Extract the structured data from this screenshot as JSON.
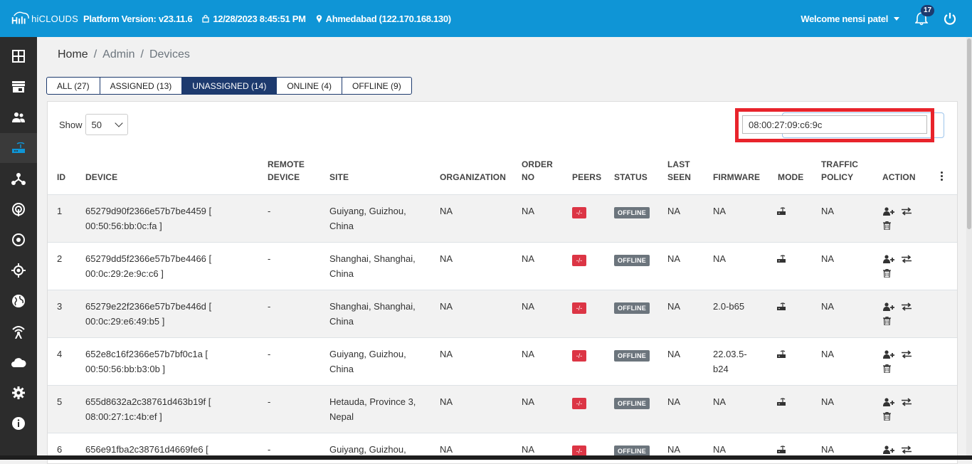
{
  "app": {
    "logo_text": "hiCLOUDS",
    "platform_version": "Platform Version: v23.11.6",
    "datetime": "12/28/2023 8:45:51 PM",
    "location": "Ahmedabad (122.170.168.130)",
    "welcome": "Welcome nensi patel",
    "notification_count": "17",
    "brand_color": "#0f95d6"
  },
  "sidebar": {
    "items": [
      {
        "icon": "dashboard-icon"
      },
      {
        "icon": "store-icon"
      },
      {
        "icon": "users-icon"
      },
      {
        "icon": "router-icon",
        "active": true
      },
      {
        "icon": "network-icon"
      },
      {
        "icon": "signal-icon"
      },
      {
        "icon": "target-icon"
      },
      {
        "icon": "crosshair-icon"
      },
      {
        "icon": "globe-icon"
      },
      {
        "icon": "wifi-tower-icon"
      },
      {
        "icon": "cloud-icon"
      },
      {
        "icon": "gear-icon"
      },
      {
        "icon": "info-icon"
      }
    ]
  },
  "breadcrumb": {
    "home": "Home",
    "sep1": "/",
    "admin": "Admin",
    "sep2": "/",
    "current": "Devices"
  },
  "tabs": [
    {
      "label": "ALL (27)"
    },
    {
      "label": "ASSIGNED (13)"
    },
    {
      "label": "UNASSIGNED (14)",
      "active": true
    },
    {
      "label": "ONLINE (4)"
    },
    {
      "label": "OFFLINE (9)"
    }
  ],
  "table_controls": {
    "show_label": "Show",
    "page_size": "50",
    "search_value": "08:00:27:09:c6:9c"
  },
  "columns": {
    "id": "ID",
    "device": "DEVICE",
    "remote_device_1": "REMOTE",
    "remote_device_2": "DEVICE",
    "site": "SITE",
    "organization": "ORGANIZATION",
    "order_no_1": "ORDER",
    "order_no_2": "NO",
    "peers": "PEERS",
    "status": "STATUS",
    "last_seen_1": "LAST",
    "last_seen_2": "SEEN",
    "firmware": "FIRMWARE",
    "mode": "MODE",
    "traffic_policy_1": "TRAFFIC",
    "traffic_policy_2": "POLICY",
    "action": "ACTION"
  },
  "rows": [
    {
      "id": "1",
      "device_1": "65279d90f2366e57b7be4459 [",
      "device_2": "00:50:56:bb:0c:fa ]",
      "remote": "-",
      "site_1": "Guiyang, Guizhou,",
      "site_2": "China",
      "org": "NA",
      "order": "NA",
      "peers": "-/-",
      "status": "OFFLINE",
      "last_seen": "NA",
      "firmware_1": "NA",
      "firmware_2": "",
      "policy": "NA"
    },
    {
      "id": "2",
      "device_1": "65279dd5f2366e57b7be4466 [",
      "device_2": "00:0c:29:2e:9c:c6 ]",
      "remote": "-",
      "site_1": "Shanghai, Shanghai,",
      "site_2": "China",
      "org": "NA",
      "order": "NA",
      "peers": "-/-",
      "status": "OFFLINE",
      "last_seen": "NA",
      "firmware_1": "NA",
      "firmware_2": "",
      "policy": "NA"
    },
    {
      "id": "3",
      "device_1": "65279e22f2366e57b7be446d [",
      "device_2": "00:0c:29:e6:49:b5 ]",
      "remote": "-",
      "site_1": "Shanghai, Shanghai,",
      "site_2": "China",
      "org": "NA",
      "order": "NA",
      "peers": "-/-",
      "status": "OFFLINE",
      "last_seen": "NA",
      "firmware_1": "2.0-b65",
      "firmware_2": "",
      "policy": "NA"
    },
    {
      "id": "4",
      "device_1": "652e8c16f2366e57b7bf0c1a [",
      "device_2": "00:50:56:bb:b3:0b ]",
      "remote": "-",
      "site_1": "Guiyang, Guizhou,",
      "site_2": "China",
      "org": "NA",
      "order": "NA",
      "peers": "-/-",
      "status": "OFFLINE",
      "last_seen": "NA",
      "firmware_1": "22.03.5-",
      "firmware_2": "b24",
      "policy": "NA"
    },
    {
      "id": "5",
      "device_1": "655d8632a2c38761d463b19f [",
      "device_2": "08:00:27:1c:4b:ef ]",
      "remote": "-",
      "site_1": "Hetauda, Province 3,",
      "site_2": "Nepal",
      "org": "NA",
      "order": "NA",
      "peers": "-/-",
      "status": "OFFLINE",
      "last_seen": "NA",
      "firmware_1": "NA",
      "firmware_2": "",
      "policy": "NA"
    },
    {
      "id": "6",
      "device_1": "656e91fba2c38761d4669fe6 [",
      "device_2": "",
      "remote": "-",
      "site_1": "Guiyang, Guizhou,",
      "site_2": "",
      "org": "NA",
      "order": "NA",
      "peers": "-/-",
      "status": "OFFLINE",
      "last_seen": "NA",
      "firmware_1": "NA",
      "firmware_2": "",
      "policy": "NA"
    }
  ]
}
